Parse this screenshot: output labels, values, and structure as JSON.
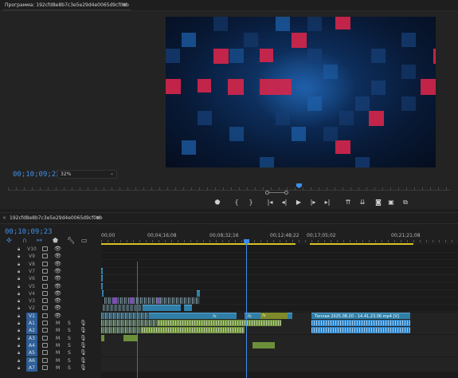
{
  "program_monitor": {
    "tab_label": "Программа: 192cfd8e8b7c3e5e29d4e0065d9cf0ab",
    "menu_icon": "≡",
    "timecode": "00;10;09;23",
    "zoom": "32%",
    "transport_icons": [
      "marker-icon",
      "mark-in-icon",
      "mark-out-icon",
      "go-to-in-icon",
      "step-back-icon",
      "play-icon",
      "step-forward-icon",
      "go-to-out-icon",
      "lift-icon",
      "extract-icon",
      "export-frame-icon",
      "comparison-icon",
      "settings-icon"
    ]
  },
  "timeline": {
    "tab_close": "×",
    "tab_label": "192cfd8e8b7c3e5e29d4e0065d9cf0ab",
    "menu_icon": "≡",
    "timecode": "00;10;09;23",
    "ruler_labels": [
      "00;00",
      "00;04;16;08",
      "00;08;32;16",
      "00;12;48;22",
      "00;17;05;02",
      "00;21;21;08"
    ],
    "video_tracks": [
      "V10",
      "V9",
      "V8",
      "V7",
      "V6",
      "V5",
      "V4",
      "V3",
      "V2",
      "V1"
    ],
    "audio_tracks": [
      "A1",
      "A2",
      "A3",
      "A4",
      "A5",
      "A6",
      "A7"
    ],
    "selected_tracks": [
      "V1",
      "A1",
      "A2",
      "A3",
      "A4",
      "A5",
      "A6",
      "A7"
    ],
    "mute_label": "M",
    "solo_label": "S",
    "clip_label": "Теплая 2025.08.20 - 14.41.23.06.mp4 [V]",
    "fx_label": "fx"
  },
  "colors": {
    "accent_blue": "#3f8fe6",
    "video_clip": "#2f7fa8",
    "audio_clip": "#6c8f3a",
    "work_area": "#d8c323"
  }
}
